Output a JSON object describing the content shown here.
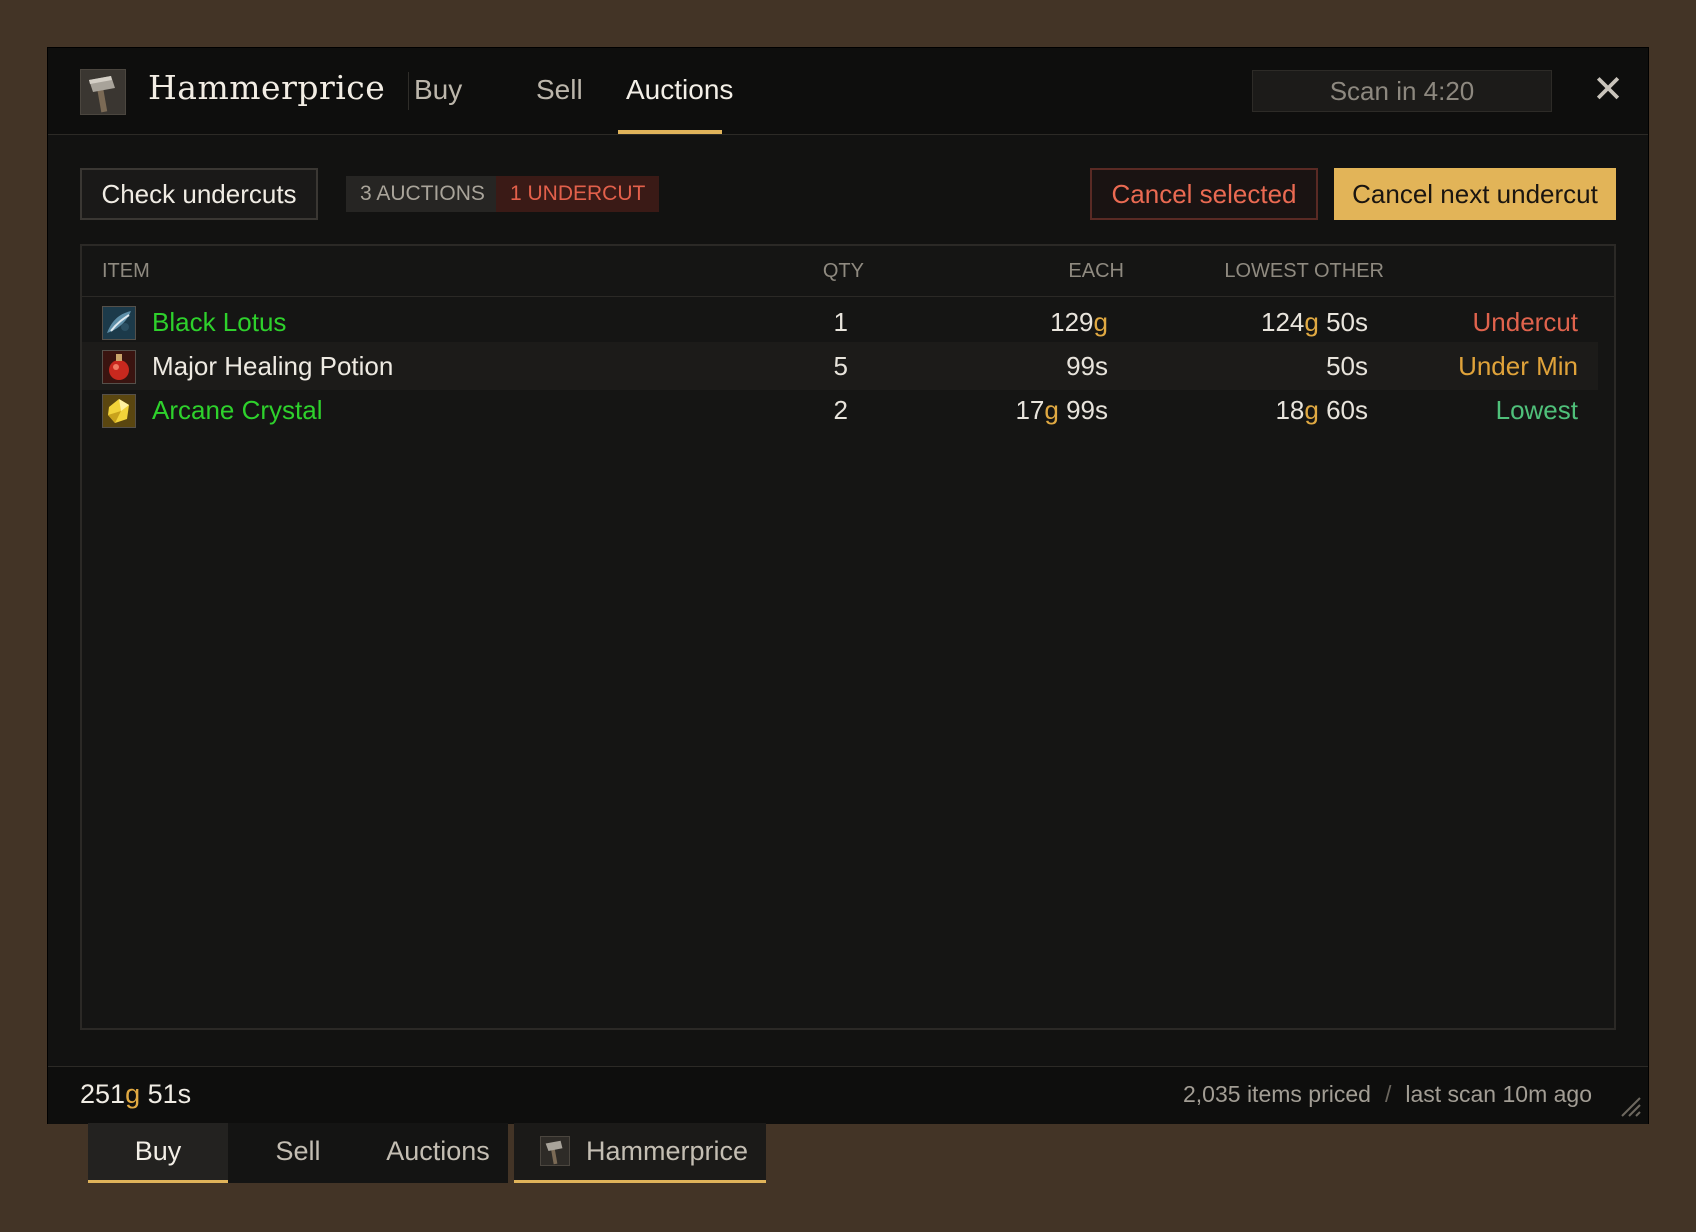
{
  "app": {
    "title": "Hammerprice",
    "icon": "hammer-icon"
  },
  "header": {
    "tabs": [
      {
        "label": "Buy",
        "active": false
      },
      {
        "label": "Sell",
        "active": false
      },
      {
        "label": "Auctions",
        "active": true
      }
    ],
    "scan_timer": "Scan in 4:20",
    "close": "✕"
  },
  "toolbar": {
    "check_label": "Check undercuts",
    "auctions_badge": "3 AUCTIONS",
    "undercut_badge": "1 UNDERCUT",
    "cancel_selected_label": "Cancel selected",
    "cancel_next_label": "Cancel next undercut"
  },
  "table": {
    "columns": [
      "ITEM",
      "QTY",
      "EACH",
      "LOWEST OTHER"
    ],
    "rows": [
      {
        "name": "Black Lotus",
        "quality": "uncommon",
        "icon": "black-lotus-icon",
        "qty": "1",
        "each": {
          "g": "129",
          "s": ""
        },
        "lowest": {
          "g": "124",
          "s": "50s"
        },
        "status": "Undercut",
        "status_type": "undercut"
      },
      {
        "name": "Major Healing Potion",
        "quality": "common",
        "icon": "healing-potion-icon",
        "qty": "5",
        "each": {
          "g": "",
          "s": "99s"
        },
        "lowest": {
          "g": "",
          "s": "50s"
        },
        "status": "Under Min",
        "status_type": "undermin"
      },
      {
        "name": "Arcane Crystal",
        "quality": "uncommon",
        "icon": "arcane-crystal-icon",
        "qty": "2",
        "each": {
          "g": "17",
          "s": "99s"
        },
        "lowest": {
          "g": "18",
          "s": "60s"
        },
        "status": "Lowest",
        "status_type": "lowest"
      }
    ]
  },
  "footer": {
    "gold": {
      "g": "251",
      "s": "51s"
    },
    "items_priced": "2,035 items priced",
    "separator": "/",
    "last_scan": "last scan 10m ago"
  },
  "bottom_tabs": [
    {
      "label": "Buy",
      "active": true
    },
    {
      "label": "Sell",
      "active": false
    },
    {
      "label": "Auctions",
      "active": false
    },
    {
      "label": "Hammerprice",
      "active": false,
      "addon": true
    }
  ],
  "gold_suffix": "g",
  "colors": {
    "accent": "#e0b35a",
    "uncommon": "#2ed12c",
    "undercut": "#e0634d",
    "undermin": "#e0a33a",
    "lowest": "#4fc07a",
    "gold": "#e0a942"
  }
}
